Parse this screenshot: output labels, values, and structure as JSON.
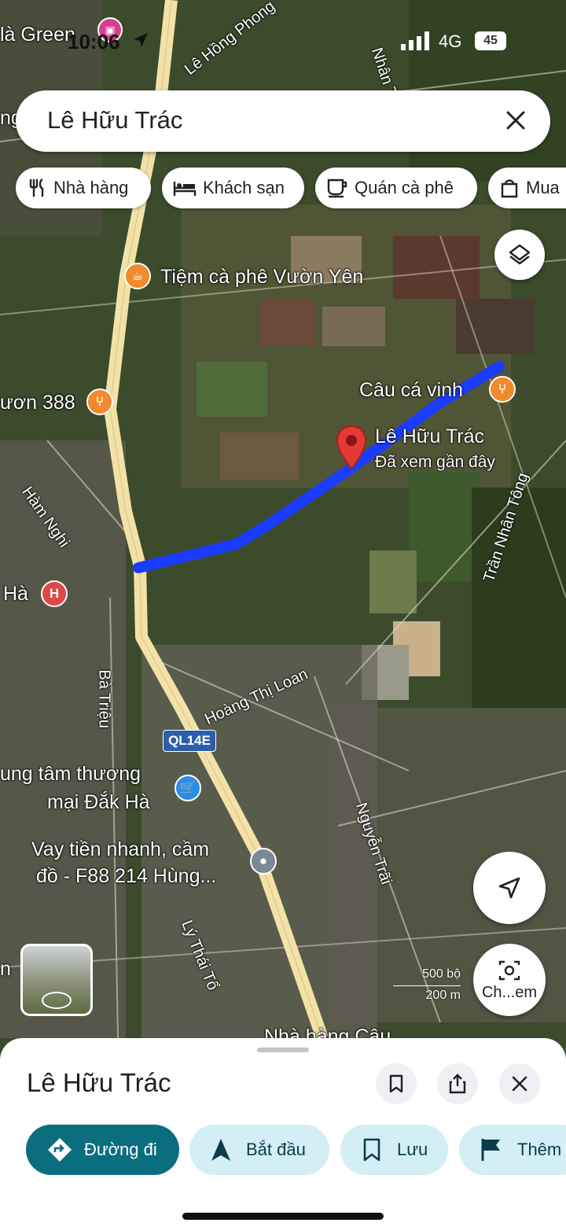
{
  "status_bar": {
    "time": "10:06",
    "network": "4G",
    "battery": "45"
  },
  "search": {
    "query": "Lê Hữu Trác"
  },
  "chips": [
    {
      "label": "Nhà hàng",
      "icon": "restaurant-icon"
    },
    {
      "label": "Khách sạn",
      "icon": "hotel-icon"
    },
    {
      "label": "Quán cà phê",
      "icon": "coffee-icon"
    },
    {
      "label": "Mua",
      "icon": "shopping-bag-icon"
    }
  ],
  "map": {
    "labels": {
      "top_left": "là Green",
      "top_left_partial": "ng",
      "vuon_388": "ươn 388",
      "ha": "Hà",
      "coffee_place": "Tiệm cà phê Vườn Yên",
      "fishing_place": "Câu cá vinh",
      "selected_place": "Lê Hữu Trác",
      "selected_sub": "Đã xem gần đây",
      "mall_line1": "ung tâm thương",
      "mall_line2": "mại Đắk Hà",
      "loan_line1": "Vay tiền nhanh, cầm",
      "loan_line2": "đồ - F88 214 Hùng...",
      "bottom_left_partial": "n",
      "bottom_partial": "Nhà hàng Câu..."
    },
    "streets": {
      "le_hong_phong": "Lê Hồng Phong",
      "nhan_tong_top": "Nhân Tông",
      "ham_nghi": "Hàm Nghi",
      "tran_nhan_tong": "Trần Nhân Tông",
      "ba_trieu": "Bà Triệu",
      "hoang_thi_loan": "Hoàng Thị Loan",
      "nguyen_trai": "Nguyễn Trãi",
      "ly_thai_to": "Lý Thái Tổ"
    },
    "road_shield": "QL14E",
    "hospital_letter": "H",
    "scale": {
      "imperial": "500 bộ",
      "metric": "200 m"
    },
    "route_color": "#1a3cff",
    "pin_color": "#e53935"
  },
  "controls": {
    "layers_icon": "layers-icon",
    "location_icon": "navigation-arrow-icon",
    "lens_label": "Ch...em"
  },
  "place_sheet": {
    "title": "Lê Hữu Trác",
    "actions": [
      {
        "label": "Đường đi",
        "icon": "directions-icon",
        "style": "primary"
      },
      {
        "label": "Bắt đầu",
        "icon": "navigation-icon",
        "style": "secondary"
      },
      {
        "label": "Lưu",
        "icon": "bookmark-icon",
        "style": "secondary"
      },
      {
        "label": "Thêm",
        "icon": "flag-icon",
        "style": "secondary"
      }
    ],
    "accent_color": "#0b6e7f",
    "secondary_bg": "#d3eef5"
  }
}
